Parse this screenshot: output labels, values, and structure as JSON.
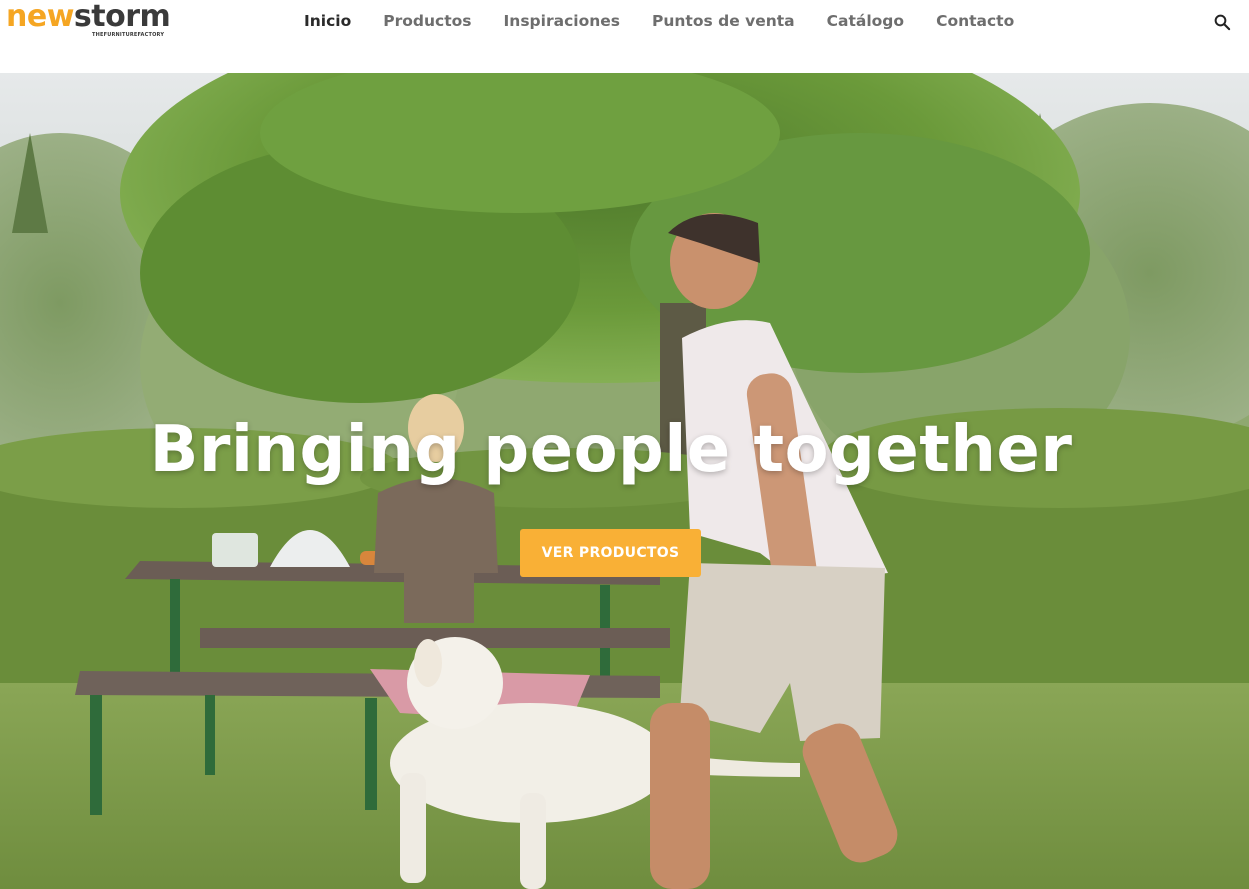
{
  "brand": {
    "logo_part_1": "new",
    "logo_part_2": "storm",
    "tagline": "THEFURNITUREFACTORY",
    "accent_color": "#f5a623",
    "dark_color": "#3a3a3a"
  },
  "nav": {
    "items": [
      {
        "label": "Inicio",
        "active": true
      },
      {
        "label": "Productos",
        "active": false
      },
      {
        "label": "Inspiraciones",
        "active": false
      },
      {
        "label": "Puntos de venta",
        "active": false
      },
      {
        "label": "Catálogo",
        "active": false
      },
      {
        "label": "Contacto",
        "active": false
      }
    ],
    "search_icon": "search-icon"
  },
  "hero": {
    "title": "Bringing people together",
    "cta_label": "VER PRODUCTOS",
    "cta_color": "#f9b036",
    "image_subject": "garden picnic scene with folding table and benches, a seated woman, a running dog and a walking man under a tree"
  }
}
